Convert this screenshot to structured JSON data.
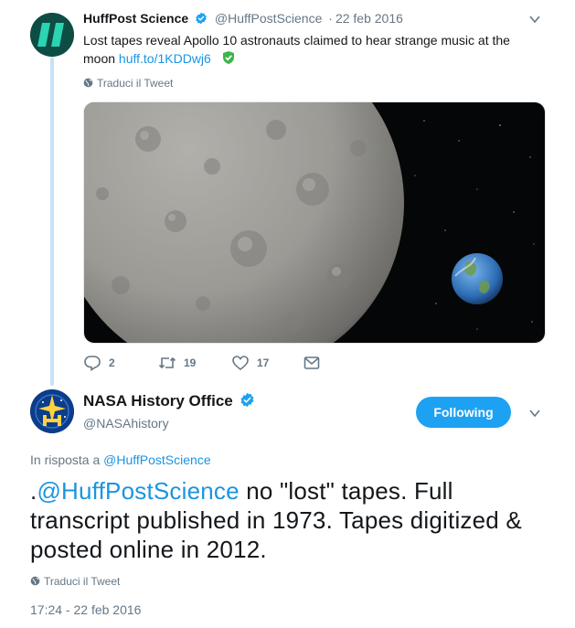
{
  "tweet1": {
    "author_name": "HuffPost Science",
    "handle": "@HuffPostScience",
    "separator": "·",
    "date": "22 feb 2016",
    "text": "Lost tapes reveal Apollo 10 astronauts claimed to hear strange music at the moon",
    "link": "huff.to/1KDDwj6",
    "translate_label": "Traduci il Tweet",
    "counts": {
      "replies": "2",
      "retweets": "19",
      "likes": "17"
    }
  },
  "tweet2": {
    "author_name": "NASA History Office",
    "handle": "@NASAhistory",
    "follow_label": "Following",
    "reply_prefix": "In risposta a",
    "reply_handle": "@HuffPostScience",
    "text_prefix": ".",
    "text_mention": "@HuffPostScience",
    "text_body": " no \"lost\" tapes. Full transcript published in 1973. Tapes digitized & posted online in 2012.",
    "translate_label": "Traduci il Tweet",
    "timestamp": "17:24 - 22 feb 2016"
  },
  "colors": {
    "link": "#1b95e0",
    "muted": "#657786",
    "follow_button": "#1da1f2",
    "thread_line": "#c4e3f6"
  },
  "icons": [
    "verified-badge-icon",
    "shield-check-icon",
    "globe-icon",
    "reply-icon",
    "retweet-icon",
    "like-icon",
    "direct-message-icon",
    "chevron-down-icon"
  ]
}
